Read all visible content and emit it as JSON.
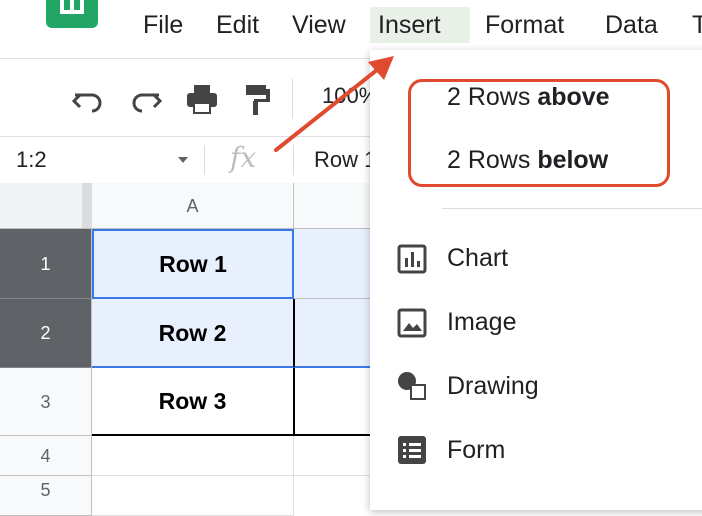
{
  "menubar": {
    "items": [
      "File",
      "Edit",
      "View",
      "Insert",
      "Format",
      "Data",
      "T"
    ],
    "active": "Insert"
  },
  "toolbar": {
    "zoom": "100%",
    "icons": [
      "undo-icon",
      "redo-icon",
      "print-icon",
      "paint-format-icon"
    ]
  },
  "formula_bar": {
    "name_box": "1:2",
    "fx_label": "fx",
    "value": "Row 1"
  },
  "grid": {
    "columns": [
      "A"
    ],
    "rows": [
      {
        "num": "1",
        "a": "Row 1",
        "selected": true
      },
      {
        "num": "2",
        "a": "Row 2",
        "selected": true
      },
      {
        "num": "3",
        "a": "Row 3",
        "selected": false
      },
      {
        "num": "4",
        "a": "",
        "selected": false
      },
      {
        "num": "5",
        "a": "",
        "selected": false
      }
    ]
  },
  "insert_menu": {
    "rows_above": {
      "prefix": "2 Rows ",
      "bold": "above"
    },
    "rows_below": {
      "prefix": "2 Rows ",
      "bold": "below"
    },
    "items": [
      {
        "label": "Chart",
        "icon": "chart-icon"
      },
      {
        "label": "Image",
        "icon": "image-icon"
      },
      {
        "label": "Drawing",
        "icon": "drawing-icon"
      },
      {
        "label": "Form",
        "icon": "form-icon"
      }
    ]
  },
  "annotation": {
    "color": "#e04a2f"
  }
}
